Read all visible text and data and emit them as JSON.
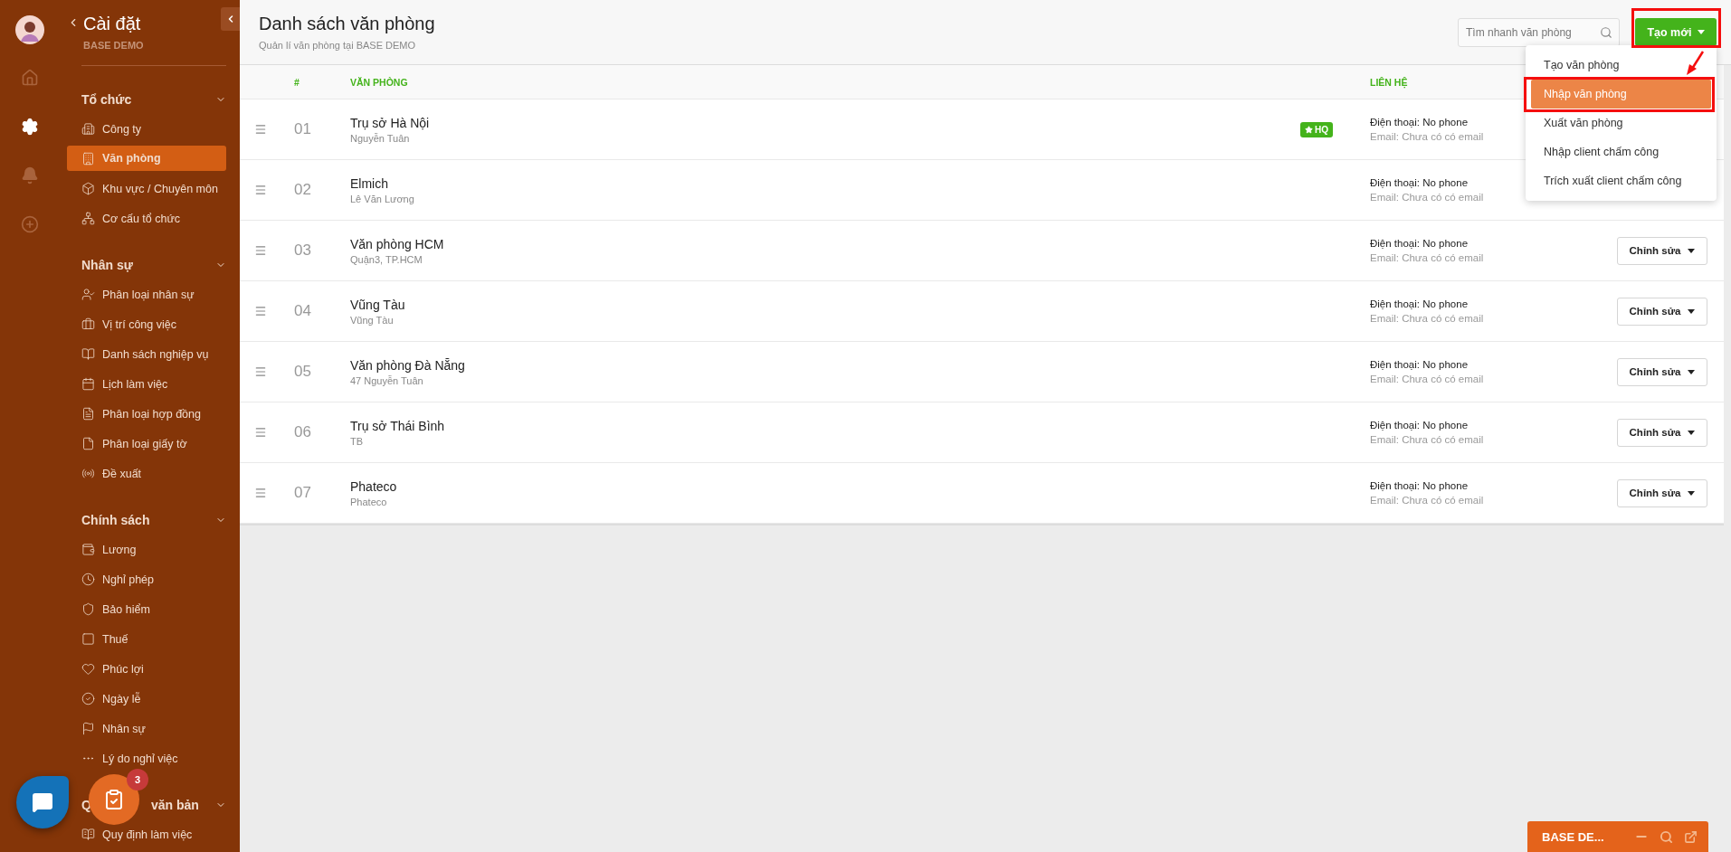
{
  "rail": [
    {
      "selected": false
    },
    {
      "selected": true
    },
    {
      "selected": false
    },
    {
      "selected": false
    }
  ],
  "settings_panel": {
    "title": "Cài đặt",
    "subtitle": "BASE DEMO",
    "sections": [
      {
        "title": "Tổ chức",
        "expanded": true,
        "items": [
          {
            "label": "Công ty",
            "selected": false
          },
          {
            "label": "Văn phòng",
            "selected": true
          },
          {
            "label": "Khu vực / Chuyên môn",
            "selected": false
          },
          {
            "label": "Cơ cấu tổ chức",
            "selected": false
          }
        ]
      },
      {
        "title": "Nhân sự",
        "expanded": true,
        "items": [
          {
            "label": "Phân loại nhân sự",
            "selected": false
          },
          {
            "label": "Vị trí công việc",
            "selected": false
          },
          {
            "label": "Danh sách nghiệp vụ",
            "selected": false
          },
          {
            "label": "Lịch làm việc",
            "selected": false
          },
          {
            "label": "Phân loại hợp đồng",
            "selected": false
          },
          {
            "label": "Phân loại giấy tờ",
            "selected": false
          },
          {
            "label": "Đề xuất",
            "selected": false
          }
        ]
      },
      {
        "title": "Chính sách",
        "expanded": true,
        "items": [
          {
            "label": "Lương",
            "selected": false
          },
          {
            "label": "Nghỉ phép",
            "selected": false
          },
          {
            "label": "Bảo hiểm",
            "selected": false
          },
          {
            "label": "Thuế",
            "selected": false
          },
          {
            "label": "Phúc lợi",
            "selected": false
          },
          {
            "label": "Ngày lễ",
            "selected": false
          },
          {
            "label": "Nhân sự",
            "selected": false
          },
          {
            "label": "Lý do nghỉ việc",
            "selected": false
          }
        ]
      },
      {
        "title": "Q",
        "title_continued": "văn bản",
        "expanded": true,
        "items": [
          {
            "label": "Quy định làm việc",
            "selected": false
          }
        ]
      }
    ]
  },
  "task_button": {
    "badge": "3"
  },
  "page": {
    "title": "Danh sách văn phòng",
    "subtitle": "Quản lí văn phòng tại BASE DEMO",
    "search": {
      "placeholder": "Tìm nhanh văn phòng"
    },
    "create_button": "Tạo mới",
    "create_menu": [
      {
        "label": "Tạo văn phòng",
        "selected": false
      },
      {
        "label": "Nhập văn phòng",
        "selected": true
      },
      {
        "label": "Xuất văn phòng",
        "selected": false
      },
      {
        "label": "Nhập client chấm công",
        "selected": false
      },
      {
        "label": "Trích xuất client chấm công",
        "selected": false
      }
    ]
  },
  "table": {
    "columns": [
      "#",
      "VĂN PHÒNG",
      "LIÊN HỆ"
    ],
    "rows": [
      {
        "number": "01",
        "name": "Trụ sở Hà Nội",
        "detail": "Nguyễn Tuân",
        "badge": "HQ",
        "phone": "Điện thoại: No phone",
        "email": "Email: Chưa có có email"
      },
      {
        "number": "02",
        "name": "Elmich",
        "detail": "Lê Văn Lương",
        "phone": "Điện thoại: No phone",
        "email": "Email: Chưa có có email"
      },
      {
        "number": "03",
        "name": "Văn phòng HCM",
        "detail": "Quận3, TP.HCM",
        "phone": "Điện thoại: No phone",
        "email": "Email: Chưa có có email",
        "edit_action": "Chỉnh sửa"
      },
      {
        "number": "04",
        "name": "Vũng Tàu",
        "detail": "Vũng Tàu",
        "phone": "Điện thoại: No phone",
        "email": "Email: Chưa có có email",
        "edit_action": "Chỉnh sửa"
      },
      {
        "number": "05",
        "name": "Văn phòng Đà Nẵng",
        "detail": "47 Nguyễn Tuân",
        "phone": "Điện thoại: No phone",
        "email": "Email: Chưa có có email",
        "edit_action": "Chỉnh sửa"
      },
      {
        "number": "06",
        "name": "Trụ sở Thái Bình",
        "detail": "TB",
        "phone": "Điện thoại: No phone",
        "email": "Email: Chưa có có email",
        "edit_action": "Chỉnh sửa"
      },
      {
        "number": "07",
        "name": "Phateco",
        "detail": "Phateco",
        "phone": "Điện thoại: No phone",
        "email": "Email: Chưa có có email",
        "edit_action": "Chỉnh sửa"
      }
    ]
  },
  "chat_widget": {
    "title": "BASE DE..."
  }
}
